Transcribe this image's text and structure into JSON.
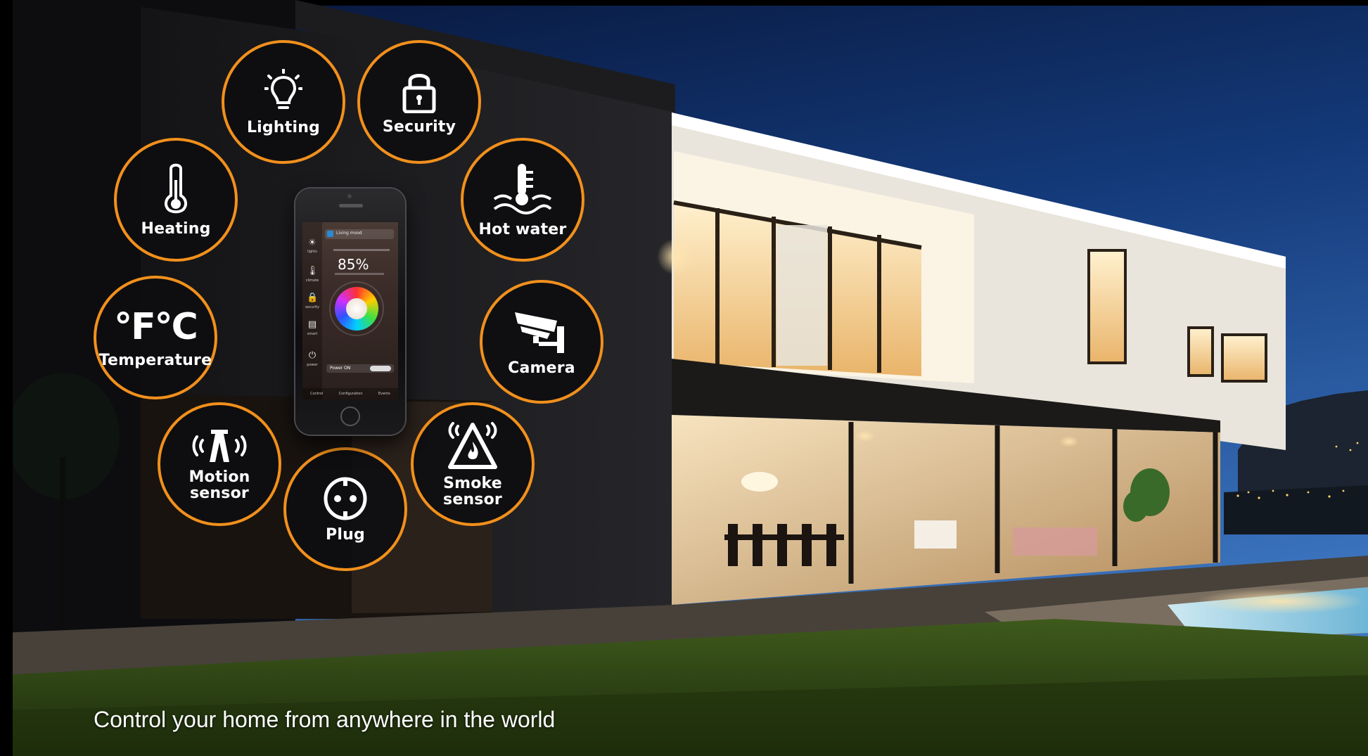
{
  "tagline": "Control your home from anywhere in the world",
  "features": {
    "lighting": {
      "label": "Lighting",
      "icon": "lightbulb-icon"
    },
    "security": {
      "label": "Security",
      "icon": "padlock-icon"
    },
    "heating": {
      "label": "Heating",
      "icon": "thermometer-icon"
    },
    "hot_water": {
      "label": "Hot water",
      "icon": "water-thermometer-icon"
    },
    "temperature": {
      "label": "Temperature",
      "icon": "fahrenheit-celsius-icon",
      "symbol": "°F°C"
    },
    "camera": {
      "label": "Camera",
      "icon": "security-camera-icon"
    },
    "motion_sensor": {
      "label_line1": "Motion",
      "label_line2": "sensor",
      "icon": "motion-sensor-icon"
    },
    "plug": {
      "label": "Plug",
      "icon": "power-socket-icon"
    },
    "smoke_sensor": {
      "label_line1": "Smoke",
      "label_line2": "sensor",
      "icon": "smoke-alarm-icon"
    }
  },
  "phone_screen": {
    "mode": "Living mood",
    "percent": "85%",
    "power_label": "Power ON",
    "tabs": [
      "Control",
      "Configuration",
      "Events"
    ],
    "side_labels": [
      "lights",
      "climate",
      "security",
      "smart",
      "power"
    ]
  },
  "colors": {
    "accent": "#f2901c",
    "circle_fill": "#0e0e10",
    "sky_top": "#0a1e4a",
    "sky_bottom": "#3d74c2",
    "interior_light": "#ffd79a"
  }
}
